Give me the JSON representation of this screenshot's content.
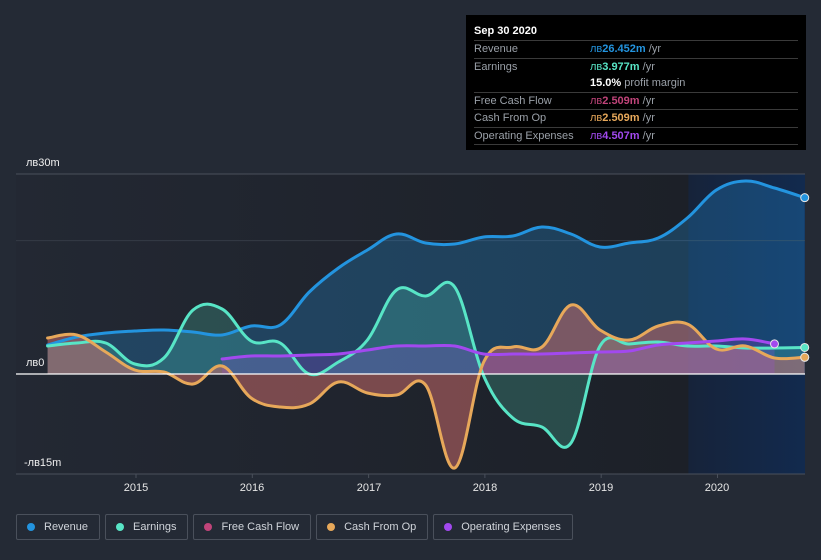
{
  "tooltip": {
    "date": "Sep 30 2020",
    "rows": [
      {
        "label": "Revenue",
        "prefix": "лв",
        "value": "26.452m",
        "unit": " /yr",
        "color": "#2394df"
      },
      {
        "label": "Earnings",
        "prefix": "лв",
        "value": "3.977m",
        "unit": " /yr",
        "color": "#58e5c6"
      },
      {
        "label": "",
        "prefix": "",
        "value": "15.0%",
        "unit": " profit margin",
        "color": "#ffffff"
      },
      {
        "label": "Free Cash Flow",
        "prefix": "лв",
        "value": "2.509m",
        "unit": " /yr",
        "color": "#c1447a"
      },
      {
        "label": "Cash From Op",
        "prefix": "лв",
        "value": "2.509m",
        "unit": " /yr",
        "color": "#e7a85a"
      },
      {
        "label": "Operating Expenses",
        "prefix": "лв",
        "value": "4.507m",
        "unit": " /yr",
        "color": "#a249ef"
      }
    ]
  },
  "legend": [
    {
      "label": "Revenue",
      "color": "#2394df"
    },
    {
      "label": "Earnings",
      "color": "#58e5c6"
    },
    {
      "label": "Free Cash Flow",
      "color": "#c1447a"
    },
    {
      "label": "Cash From Op",
      "color": "#e7a85a"
    },
    {
      "label": "Operating Expenses",
      "color": "#a249ef"
    }
  ],
  "chart_data": {
    "type": "area",
    "title": "",
    "xlabel": "",
    "ylabel": "",
    "currency_prefix": "лв",
    "ylim": [
      -15,
      30
    ],
    "y_tick_labels": [
      "лв30m",
      "лв0",
      "-лв15m"
    ],
    "y_ticks": [
      30,
      0,
      -15
    ],
    "gridlines": [
      30,
      20
    ],
    "x_tick_labels": [
      "2015",
      "2016",
      "2017",
      "2018",
      "2019",
      "2020"
    ],
    "x_ticks": [
      2015,
      2016,
      2017,
      2018,
      2019,
      2020
    ],
    "xlim": [
      2014.24,
      2020.75
    ],
    "highlight_from": 2019.75,
    "x": [
      2014.24,
      2014.49,
      2014.74,
      2014.99,
      2015.24,
      2015.49,
      2015.74,
      2015.99,
      2016.24,
      2016.49,
      2016.74,
      2016.99,
      2017.24,
      2017.49,
      2017.74,
      2017.99,
      2018.24,
      2018.49,
      2018.74,
      2018.99,
      2019.24,
      2019.49,
      2019.74,
      2019.99,
      2020.24,
      2020.49,
      2020.75
    ],
    "series": [
      {
        "name": "Revenue",
        "color": "#2394df",
        "start_index": 0,
        "values": [
          4.35,
          5.55,
          6.15,
          6.45,
          6.6,
          6.3,
          5.85,
          7.2,
          7.35,
          12.3,
          15.9,
          18.6,
          21.0,
          19.65,
          19.5,
          20.55,
          20.7,
          22.05,
          21.0,
          19.05,
          19.65,
          20.4,
          23.4,
          27.6,
          28.95,
          27.9,
          26.45
        ]
      },
      {
        "name": "Earnings",
        "color": "#58e5c6",
        "start_index": 0,
        "values": [
          4.2,
          4.65,
          4.65,
          1.5,
          2.4,
          9.6,
          9.75,
          4.95,
          4.65,
          0.0,
          1.8,
          5.1,
          12.6,
          11.7,
          13.05,
          -0.3,
          -6.6,
          -7.95,
          -10.35,
          4.2,
          4.5,
          4.8,
          4.2,
          4.2,
          3.9,
          3.9,
          3.98
        ]
      },
      {
        "name": "Free Cash Flow",
        "color": "#c1447a",
        "start_index": 0,
        "values": [
          5.4,
          5.85,
          3.3,
          0.6,
          0.3,
          -1.5,
          1.2,
          -3.6,
          -4.95,
          -4.5,
          -1.2,
          -2.85,
          -3.15,
          -1.65,
          -14.1,
          1.8,
          4.05,
          4.05,
          10.35,
          6.6,
          5.1,
          7.2,
          7.5,
          3.75,
          4.2,
          2.4,
          2.51
        ]
      },
      {
        "name": "Cash From Op",
        "color": "#e7a85a",
        "start_index": 0,
        "values": [
          5.4,
          5.85,
          3.3,
          0.6,
          0.3,
          -1.5,
          1.2,
          -3.6,
          -4.95,
          -4.5,
          -1.2,
          -2.85,
          -3.15,
          -1.65,
          -14.1,
          1.8,
          4.05,
          4.05,
          10.35,
          6.6,
          5.1,
          7.2,
          7.5,
          3.75,
          4.2,
          2.4,
          2.51
        ]
      },
      {
        "name": "Operating Expenses",
        "color": "#a249ef",
        "start_index": 6,
        "values": [
          2.25,
          2.7,
          2.7,
          2.85,
          3.0,
          3.6,
          4.2,
          4.2,
          4.2,
          3.0,
          3.0,
          3.0,
          3.15,
          3.3,
          3.45,
          4.35,
          4.65,
          4.95,
          5.25,
          4.51
        ]
      }
    ],
    "legend_position": "bottom-left"
  }
}
